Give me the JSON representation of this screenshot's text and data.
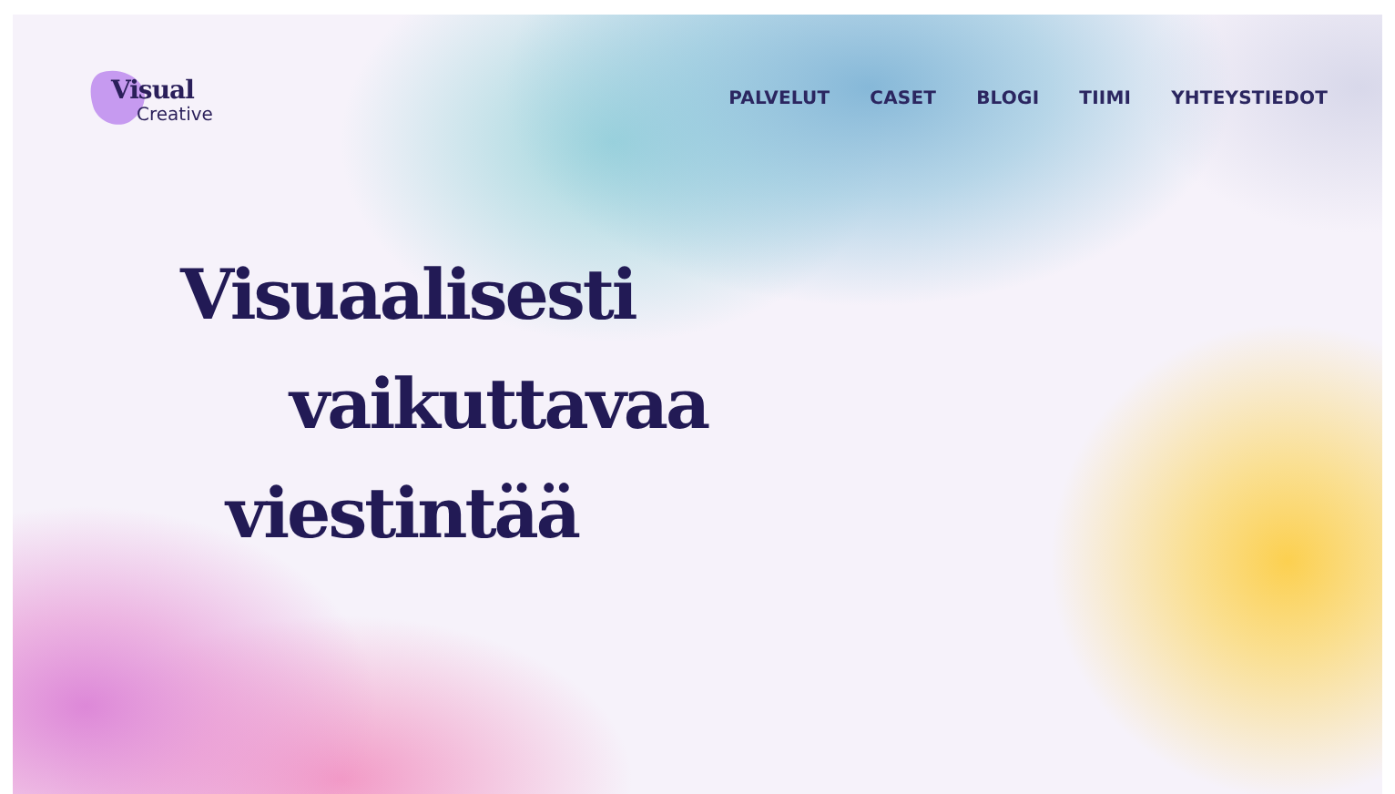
{
  "logo": {
    "word_1": "Visual",
    "word_2": "Creative"
  },
  "nav": [
    {
      "label": "PALVELUT"
    },
    {
      "label": "CASET"
    },
    {
      "label": "BLOGI"
    },
    {
      "label": "TIIMI"
    },
    {
      "label": "YHTEYSTIEDOT"
    }
  ],
  "headline": [
    "Visuaalisesti",
    "vaikuttavaa",
    "viestintää"
  ]
}
